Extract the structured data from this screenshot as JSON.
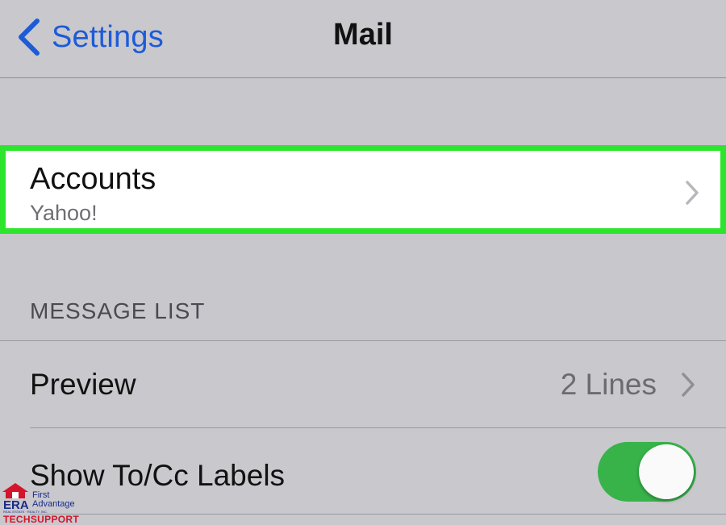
{
  "navbar": {
    "back_label": "Settings",
    "title": "Mail"
  },
  "accounts": {
    "title": "Accounts",
    "subtitle": "Yahoo!",
    "highlight_color": "#2de52d"
  },
  "message_list": {
    "header": "MESSAGE LIST",
    "preview": {
      "label": "Preview",
      "value": "2 Lines"
    },
    "show_to_cc": {
      "label": "Show To/Cc Labels",
      "toggle_on": true
    }
  },
  "watermark": {
    "brand": "ERA",
    "line1": "First",
    "line2": "Advantage",
    "small": "REAL ESTATE · REALTY, INC.",
    "tag": "TECHSUPPORT"
  },
  "colors": {
    "link_blue": "#1d5bd8",
    "toggle_green": "#37b34a",
    "background_gray": "#c8c7cc"
  },
  "icons": {
    "back": "chevron-left-icon",
    "disclosure": "chevron-right-icon"
  }
}
